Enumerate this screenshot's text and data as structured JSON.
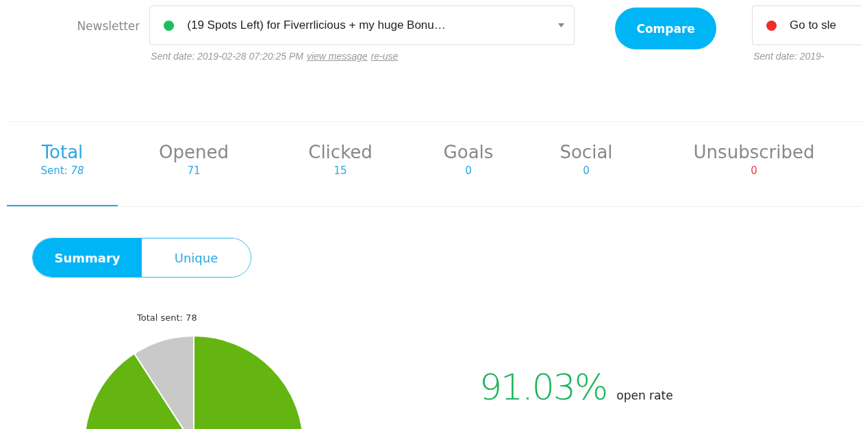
{
  "newsletter": {
    "label": "Newsletter",
    "selected": {
      "title": "(19 Spots Left) for Fiverrlicious + my huge Bonu…",
      "color": "#1bbf5c",
      "sent_date": "Sent date: 2019-02-28 07:20:25 PM",
      "links": [
        "view message",
        "re-use"
      ]
    },
    "compare_button": "Compare",
    "compared": {
      "title": "Go to sle",
      "color": "#ee2d2d",
      "sent_date": "Sent date: 2019-"
    }
  },
  "tabs": [
    {
      "label": "Total",
      "value": "Sent: *78*",
      "selected": true,
      "color": "#29a9e0"
    },
    {
      "label": "Opened",
      "value": "71",
      "selected": false,
      "color": "#29a9e0"
    },
    {
      "label": "Clicked",
      "value": "15",
      "selected": false,
      "color": "#29a9e0"
    },
    {
      "label": "Goals",
      "value": "0",
      "selected": false,
      "color": "#29a9e0"
    },
    {
      "label": "Social",
      "value": "0",
      "selected": false,
      "color": "#29a9e0"
    },
    {
      "label": "Unsubscribed",
      "value": "0",
      "selected": false,
      "color": "#e8404a"
    }
  ],
  "view_toggle": [
    {
      "label": "Summary",
      "selected": true
    },
    {
      "label": "Unique",
      "selected": false
    }
  ],
  "pie": {
    "title": "Total sent: 78"
  },
  "open_rate": {
    "value": "91.03%",
    "label": "open rate"
  }
}
